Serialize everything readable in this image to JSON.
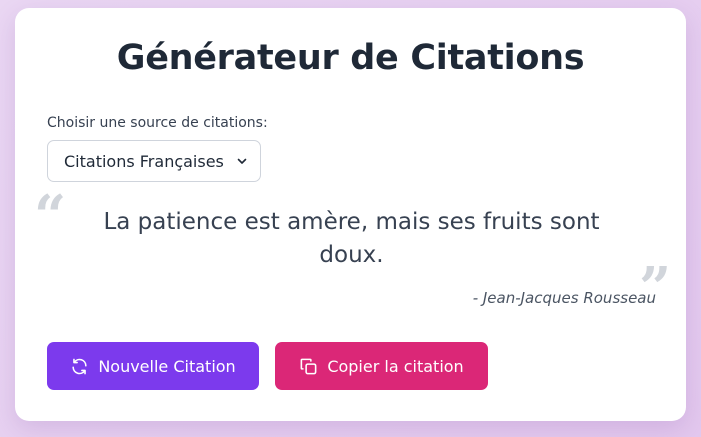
{
  "app": {
    "title": "Générateur de Citations"
  },
  "source_select": {
    "label": "Choisir une source de citations:",
    "selected": "Citations Françaises"
  },
  "quote": {
    "open_mark": "“",
    "close_mark": "”",
    "text": "La patience est amère, mais ses fruits sont doux.",
    "author": "- Jean-Jacques Rousseau"
  },
  "actions": {
    "new_label": "Nouvelle Citation",
    "new_icon": "refresh-icon",
    "copy_label": "Copier la citation",
    "copy_icon": "copy-icon"
  },
  "colors": {
    "primary": "#7c3aed",
    "secondary": "#db2777",
    "background": "#e8d2f2"
  }
}
